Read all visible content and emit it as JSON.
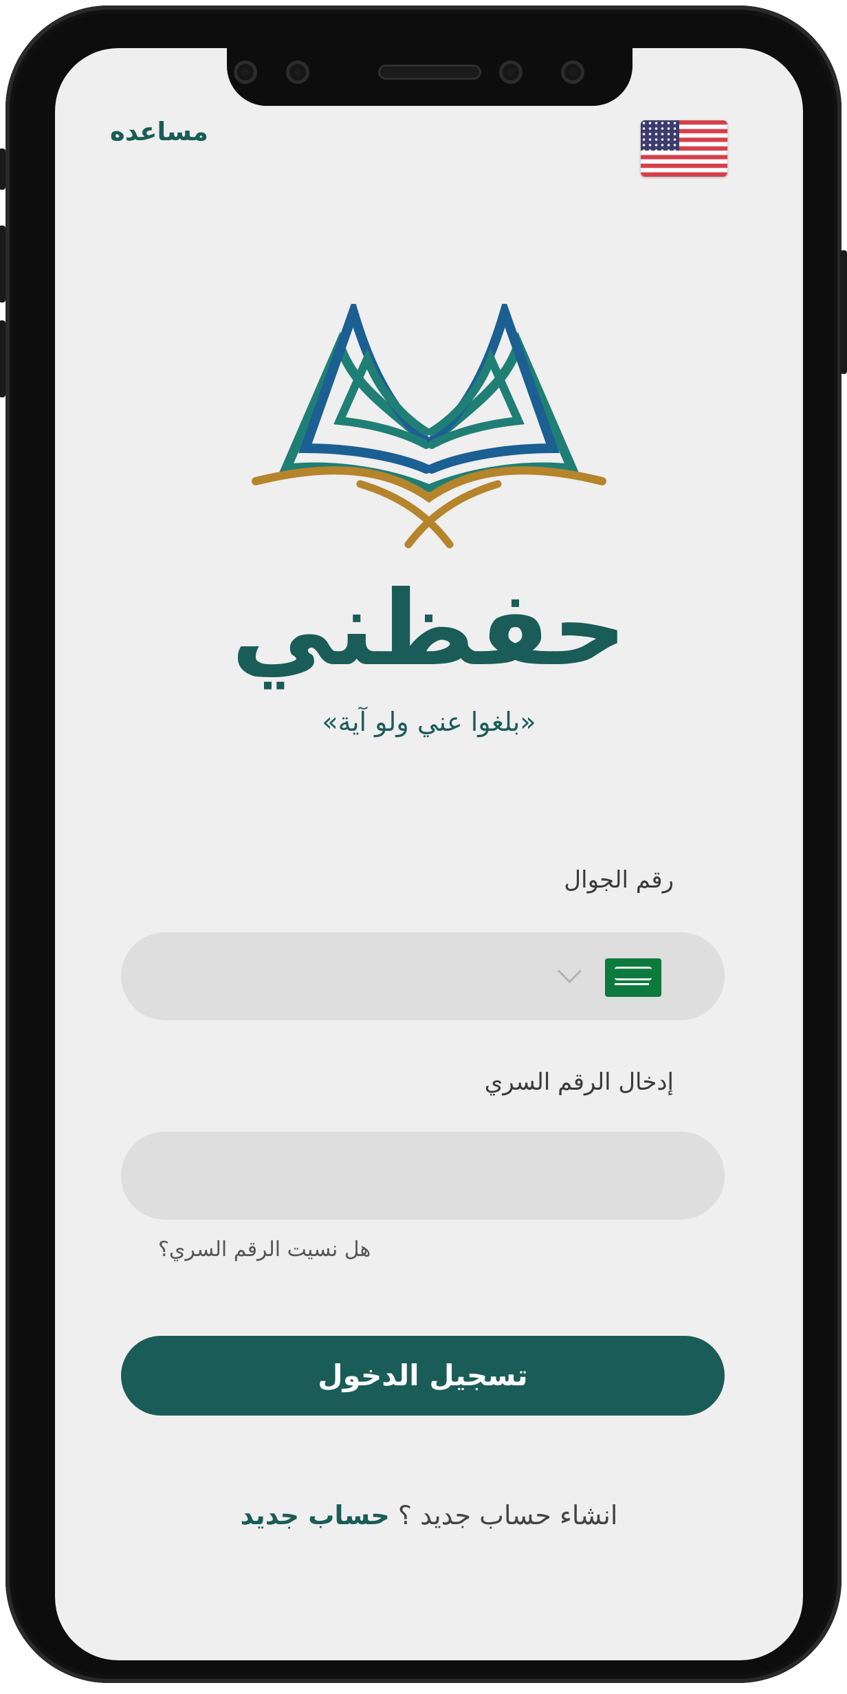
{
  "header": {
    "help_label": "مساعده",
    "language_flag_icon": "us-flag-icon"
  },
  "brand": {
    "logo_icon": "open-book-logo",
    "app_name": "حفظني",
    "tagline": "«بلغوا عني ولو آية»"
  },
  "form": {
    "phone_label": "رقم الجوال",
    "phone_value": "",
    "country_flag_icon": "saudi-flag-icon",
    "password_label": "إدخال الرقم السري",
    "password_value": "",
    "forgot_password": "هل نسيت الرقم السري؟",
    "login_label": "تسجيل الدخول"
  },
  "signup": {
    "question": "انشاء حساب جديد ؟",
    "link": "حساب جديد"
  },
  "colors": {
    "primary": "#1a5c57",
    "logo_blue": "#1b5f93",
    "logo_teal": "#1f7f74",
    "logo_gold": "#b5842b",
    "field_bg": "#dedede",
    "screen_bg": "#efefef"
  }
}
